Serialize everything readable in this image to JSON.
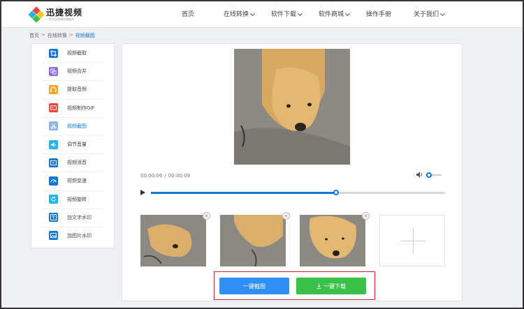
{
  "header": {
    "logo_title": "迅捷视频",
    "logo_subtitle": "一款专业视频处理软件",
    "nav": [
      {
        "label": "首页",
        "has_menu": false
      },
      {
        "label": "在线转换",
        "has_menu": true
      },
      {
        "label": "软件下载",
        "has_menu": true
      },
      {
        "label": "软件商城",
        "has_menu": true
      },
      {
        "label": "操作手册",
        "has_menu": false
      },
      {
        "label": "关于我们",
        "has_menu": true
      }
    ]
  },
  "breadcrumb": {
    "home": "首页",
    "sep": ">",
    "section": "在线转换",
    "current": "视频截图"
  },
  "sidebar": {
    "items": [
      {
        "label": "视频截取",
        "icon": "crop-icon",
        "color": "#1677d2"
      },
      {
        "label": "视频合并",
        "icon": "merge-icon",
        "color": "#8a6fdc"
      },
      {
        "label": "提取音频",
        "icon": "headphone-icon",
        "color": "#f5a623"
      },
      {
        "label": "视频制作GIF",
        "icon": "gif-icon",
        "color": "#e8453c"
      },
      {
        "label": "视频截图",
        "icon": "scissors-icon",
        "color": "#8ab4e8",
        "active": true
      },
      {
        "label": "调节音量",
        "icon": "volume-icon",
        "color": "#27b3e6"
      },
      {
        "label": "视频消音",
        "icon": "mute-play-icon",
        "color": "#1677d2"
      },
      {
        "label": "视频变速",
        "icon": "speed-icon",
        "color": "#1677d2"
      },
      {
        "label": "视频旋转",
        "icon": "rotate-icon",
        "color": "#27b3e6"
      },
      {
        "label": "加文字水印",
        "icon": "text-watermark-icon",
        "color": "#1677d2"
      },
      {
        "label": "加图片水印",
        "icon": "image-watermark-icon",
        "color": "#1677d2"
      }
    ]
  },
  "player": {
    "current_time": "00:00:06",
    "separator": "/",
    "duration": "00:00:09",
    "progress_fraction": 0.63,
    "volume_fraction": 0.0
  },
  "thumbnails": {
    "close_glyph": "×"
  },
  "buttons": {
    "capture_label": "一键截图",
    "download_label": "一键下载"
  }
}
